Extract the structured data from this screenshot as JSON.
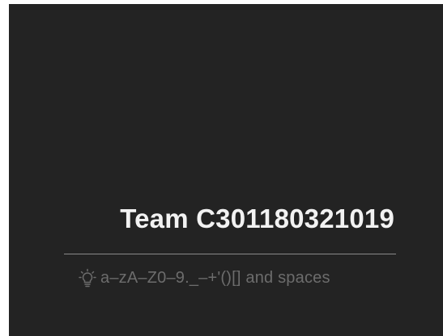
{
  "rename": {
    "value": "Team C301180321019",
    "hint": "a–zA–Z0–9._–+'()[] and spaces",
    "hint_icon": "lightbulb-icon"
  },
  "colors": {
    "background": "#232323",
    "text": "#f2f2f2",
    "hint_text": "#6c6c6c",
    "underline": "#8a8a8a"
  }
}
